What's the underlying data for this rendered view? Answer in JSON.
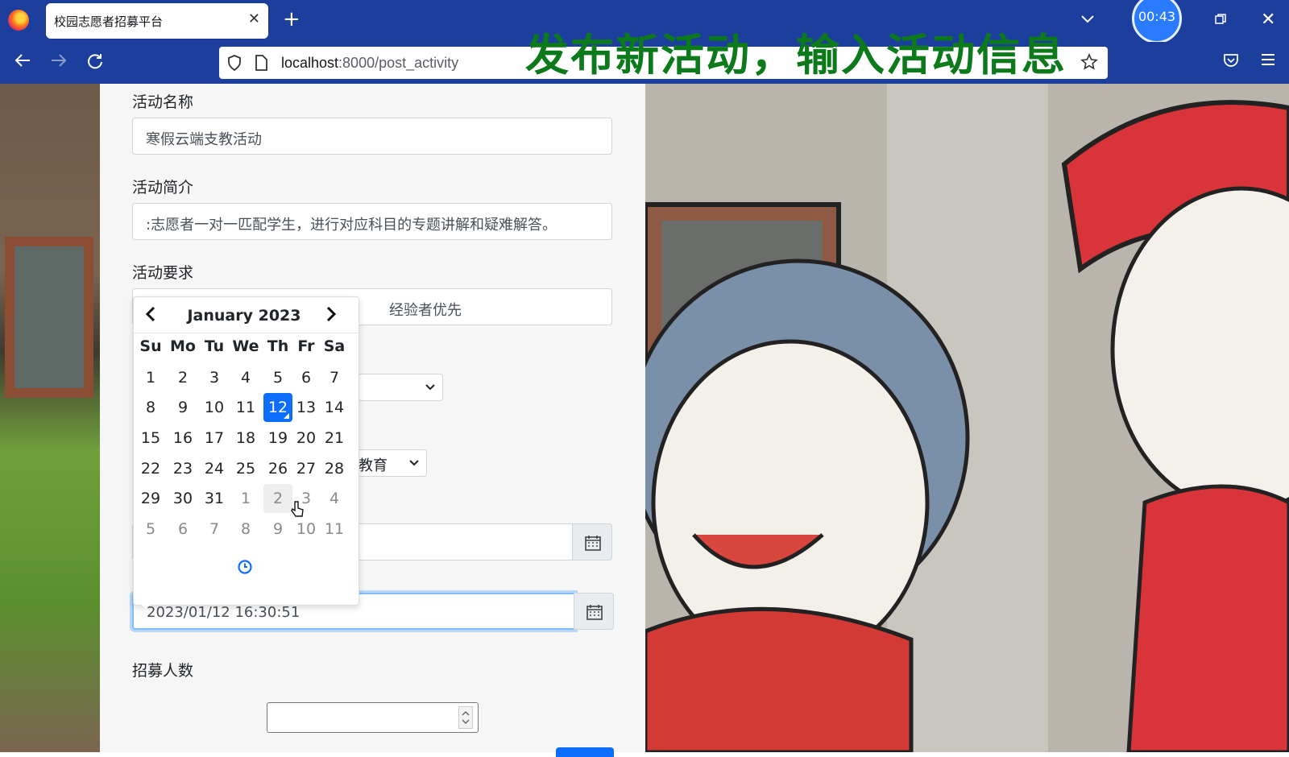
{
  "browser": {
    "tab_title": "校园志愿者招募平台",
    "url_host": "localhost",
    "url_path": ":8000/post_activity",
    "timer": "00:43"
  },
  "overlay_caption": "发布新活动，输入活动信息",
  "form": {
    "name_label": "活动名称",
    "name_value": "寒假云端支教活动",
    "intro_label": "活动简介",
    "intro_value": ":志愿者一对一匹配学生，进行对应科目的专题讲解和疑难解答。",
    "req_label": "活动要求",
    "req_value_visible": "经验者优先",
    "category_visible": "教育",
    "end_time_value": "2023/01/12 16:30:51",
    "recruit_label": "招募人数"
  },
  "datepicker": {
    "month_title": "January 2023",
    "weekdays": [
      "Su",
      "Mo",
      "Tu",
      "We",
      "Th",
      "Fr",
      "Sa"
    ],
    "weeks": [
      [
        "1",
        "2",
        "3",
        "4",
        "5",
        "6",
        "7"
      ],
      [
        "8",
        "9",
        "10",
        "11",
        "12",
        "13",
        "14"
      ],
      [
        "15",
        "16",
        "17",
        "18",
        "19",
        "20",
        "21"
      ],
      [
        "22",
        "23",
        "24",
        "25",
        "26",
        "27",
        "28"
      ],
      [
        "29",
        "30",
        "31",
        "1",
        "2",
        "3",
        "4"
      ],
      [
        "5",
        "6",
        "7",
        "8",
        "9",
        "10",
        "11"
      ]
    ],
    "selected": "12",
    "other_month_from_week": 4
  },
  "icons": [
    "firefox-logo",
    "close-icon",
    "plus-icon",
    "chevron-down-icon",
    "back-icon",
    "forward-icon",
    "reload-icon",
    "shield-icon",
    "page-icon",
    "star-icon",
    "pocket-icon",
    "menu-icon",
    "calendar-icon",
    "clock-icon",
    "chevron-left-icon",
    "chevron-right-icon"
  ],
  "colors": {
    "chrome": "#1c3f9e",
    "accent": "#0d6efd",
    "caption": "#0c7a1b"
  }
}
